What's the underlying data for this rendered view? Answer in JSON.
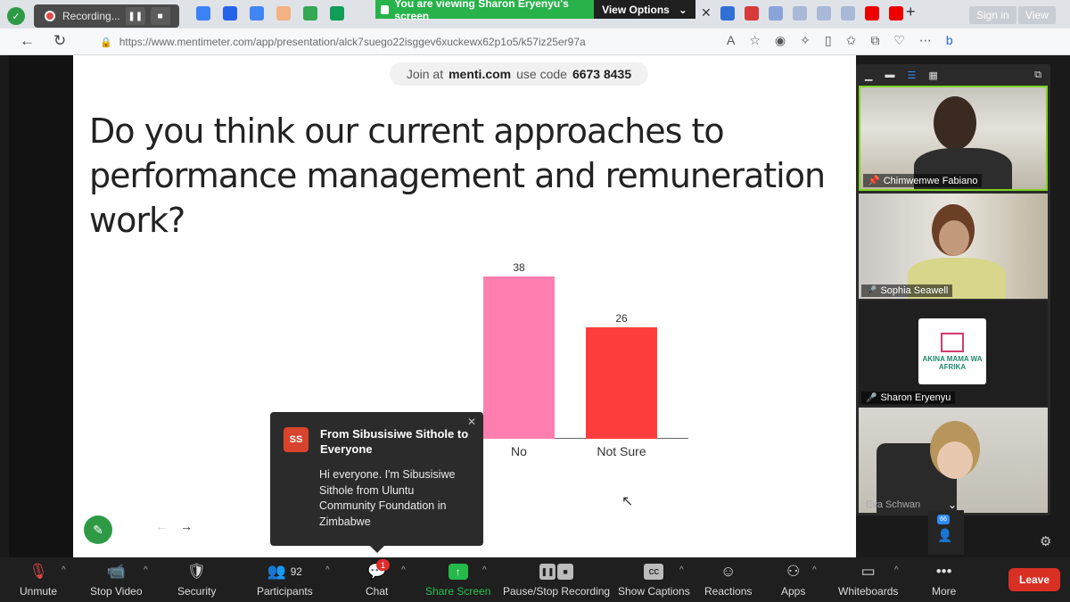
{
  "recording": {
    "label": "Recording..."
  },
  "banner": {
    "viewing_text": "You are viewing Sharon Eryenyu's screen",
    "view_options": "View Options"
  },
  "browser": {
    "sign_in": "Sign in",
    "view": "View",
    "url": "https://www.mentimeter.com/app/presentation/alck7suego22isggev6xuckewx62p1o5/k57iz25er97a"
  },
  "slide": {
    "join_prefix": "Join at",
    "join_site": "menti.com",
    "join_mid": "use code",
    "join_code": "6673 8435",
    "question": "Do you think our current approaches to performance management and remuneration work?"
  },
  "chart_data": {
    "type": "bar",
    "categories": [
      "No",
      "Not Sure"
    ],
    "values": [
      38,
      26
    ],
    "colors": [
      "#ff7eb0",
      "#ff3d3d"
    ]
  },
  "chat_popup": {
    "avatar_initials": "SS",
    "from": "From Sibusisiwe Sithole to Everyone",
    "message": "Hi everyone. I'm Sibusisiwe Sithole from Uluntu Community Foundation in Zimbabwe"
  },
  "participants": {
    "tiles": [
      {
        "name": "Chimwemwe Fabiano"
      },
      {
        "name": "Sophia Seawell"
      },
      {
        "name": "Sharon Eryenyu"
      },
      {
        "name": "Eva Schwan"
      }
    ],
    "logo_text": "AKINA MAMA WA AFRIKA",
    "count_badge": "66"
  },
  "toolbar": {
    "unmute": "Unmute",
    "stop_video": "Stop Video",
    "security": "Security",
    "participants": "Participants",
    "participants_count": "92",
    "chat": "Chat",
    "chat_badge": "1",
    "share_screen": "Share Screen",
    "pause_recording": "Pause/Stop Recording",
    "captions": "Show Captions",
    "reactions": "Reactions",
    "apps": "Apps",
    "whiteboards": "Whiteboards",
    "more": "More",
    "leave": "Leave",
    "cc": "CC"
  }
}
